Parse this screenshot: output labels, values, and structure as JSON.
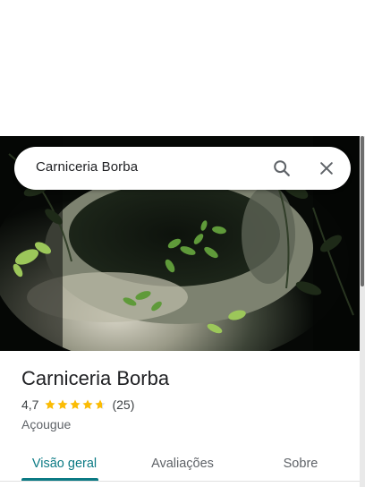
{
  "search": {
    "query": "Carniceria Borba",
    "search_icon": "search-icon",
    "close_icon": "close-icon"
  },
  "place": {
    "title": "Carniceria Borba",
    "rating": "4,7",
    "rating_value": 4.7,
    "review_count": "(25)",
    "category": "Açougue",
    "star_color": "#fbbc04",
    "star_empty_color": "#dadce0"
  },
  "tabs": [
    {
      "label": "Visão geral",
      "active": true
    },
    {
      "label": "Avaliações",
      "active": false
    },
    {
      "label": "Sobre",
      "active": false
    }
  ],
  "colors": {
    "accent": "#0b7a84",
    "text_primary": "#202124",
    "text_secondary": "#5f6368"
  }
}
